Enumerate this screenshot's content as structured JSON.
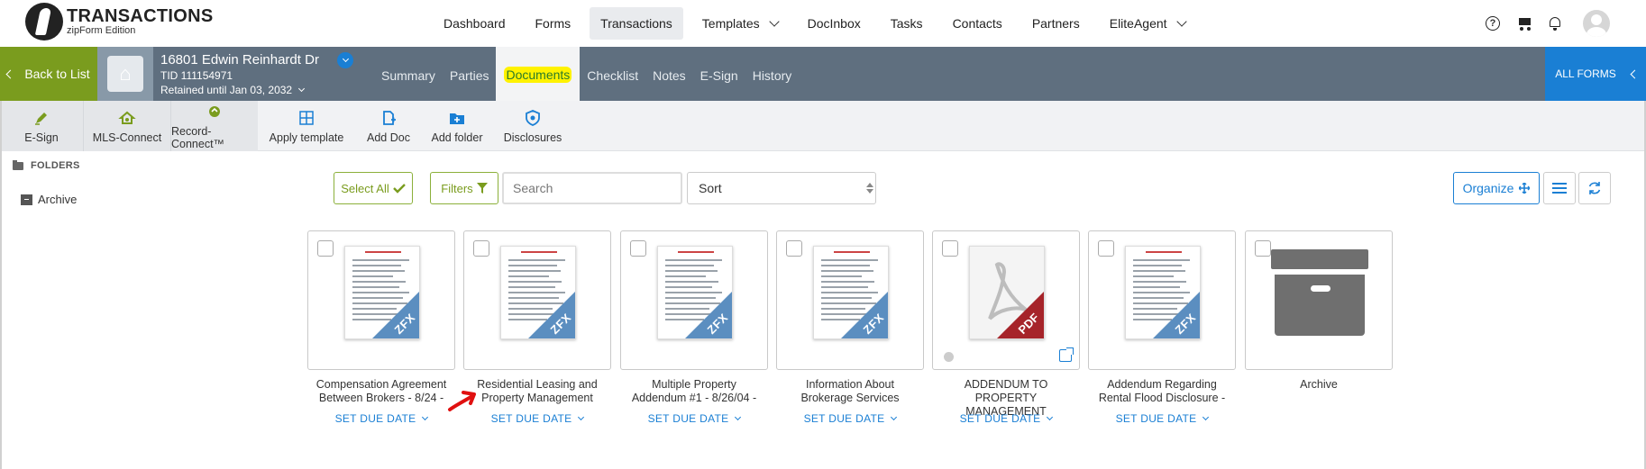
{
  "app": {
    "title": "TRANSACTIONS",
    "subtitle": "zipForm Edition"
  },
  "nav": {
    "items": [
      {
        "label": "Dashboard",
        "active": false,
        "dropdown": false
      },
      {
        "label": "Forms",
        "active": false,
        "dropdown": false
      },
      {
        "label": "Transactions",
        "active": true,
        "dropdown": false
      },
      {
        "label": "Templates",
        "active": false,
        "dropdown": true
      },
      {
        "label": "DocInbox",
        "active": false,
        "dropdown": false
      },
      {
        "label": "Tasks",
        "active": false,
        "dropdown": false
      },
      {
        "label": "Contacts",
        "active": false,
        "dropdown": false
      },
      {
        "label": "Partners",
        "active": false,
        "dropdown": false
      },
      {
        "label": "EliteAgent",
        "active": false,
        "dropdown": true
      }
    ],
    "icons": [
      "help-icon",
      "cart-icon",
      "bell-icon",
      "avatar"
    ]
  },
  "transaction": {
    "back_label": "Back to List",
    "address": "16801 Edwin Reinhardt Dr",
    "tid": "TID 111154971",
    "retained": "Retained until Jan 03, 2032",
    "tabs": [
      "Summary",
      "Parties",
      "Documents",
      "Checklist",
      "Notes",
      "E-Sign",
      "History"
    ],
    "active_tab": "Documents",
    "all_forms_label": "ALL FORMS"
  },
  "toolbar": {
    "esign": "E-Sign",
    "mls_connect": "MLS-Connect",
    "record_connect": "Record-Connect™",
    "apply_template": "Apply template",
    "add_doc": "Add Doc",
    "add_folder": "Add folder",
    "disclosures": "Disclosures"
  },
  "sidebar": {
    "heading": "FOLDERS",
    "items": [
      "Archive"
    ]
  },
  "controls": {
    "select_all": "Select All",
    "filters": "Filters",
    "search_placeholder": "Search",
    "sort_label": "Sort",
    "organize": "Organize"
  },
  "documents": [
    {
      "title_line1": "Compensation Agreement",
      "title_line2": "Between Brokers - 8/24 -",
      "due": "SET DUE DATE",
      "type": "zfx"
    },
    {
      "title_line1": "Residential Leasing and",
      "title_line2": "Property Management",
      "due": "SET DUE DATE",
      "type": "zfx"
    },
    {
      "title_line1": "Multiple Property",
      "title_line2": "Addendum #1 - 8/26/04 -",
      "due": "SET DUE DATE",
      "type": "zfx"
    },
    {
      "title_line1": "Information About",
      "title_line2": "Brokerage Services",
      "due": "SET DUE DATE",
      "type": "zfx"
    },
    {
      "title_line1": "ADDENDUM TO PROPERTY",
      "title_line2": "MANAGEMENT",
      "due": "SET DUE DATE",
      "type": "pdf"
    },
    {
      "title_line1": "Addendum Regarding",
      "title_line2": "Rental Flood Disclosure -",
      "due": "SET DUE DATE",
      "type": "zfx"
    },
    {
      "title_line1": "Archive",
      "title_line2": "",
      "due": "",
      "type": "folder"
    }
  ],
  "badges": {
    "zfx": "ZFX",
    "pdf": "PDF"
  },
  "colors": {
    "green": "#7a9c1e",
    "blue": "#1a7fd4",
    "bar": "#5f6f7f",
    "highlight": "#fff200",
    "annotation": "#e01010"
  }
}
